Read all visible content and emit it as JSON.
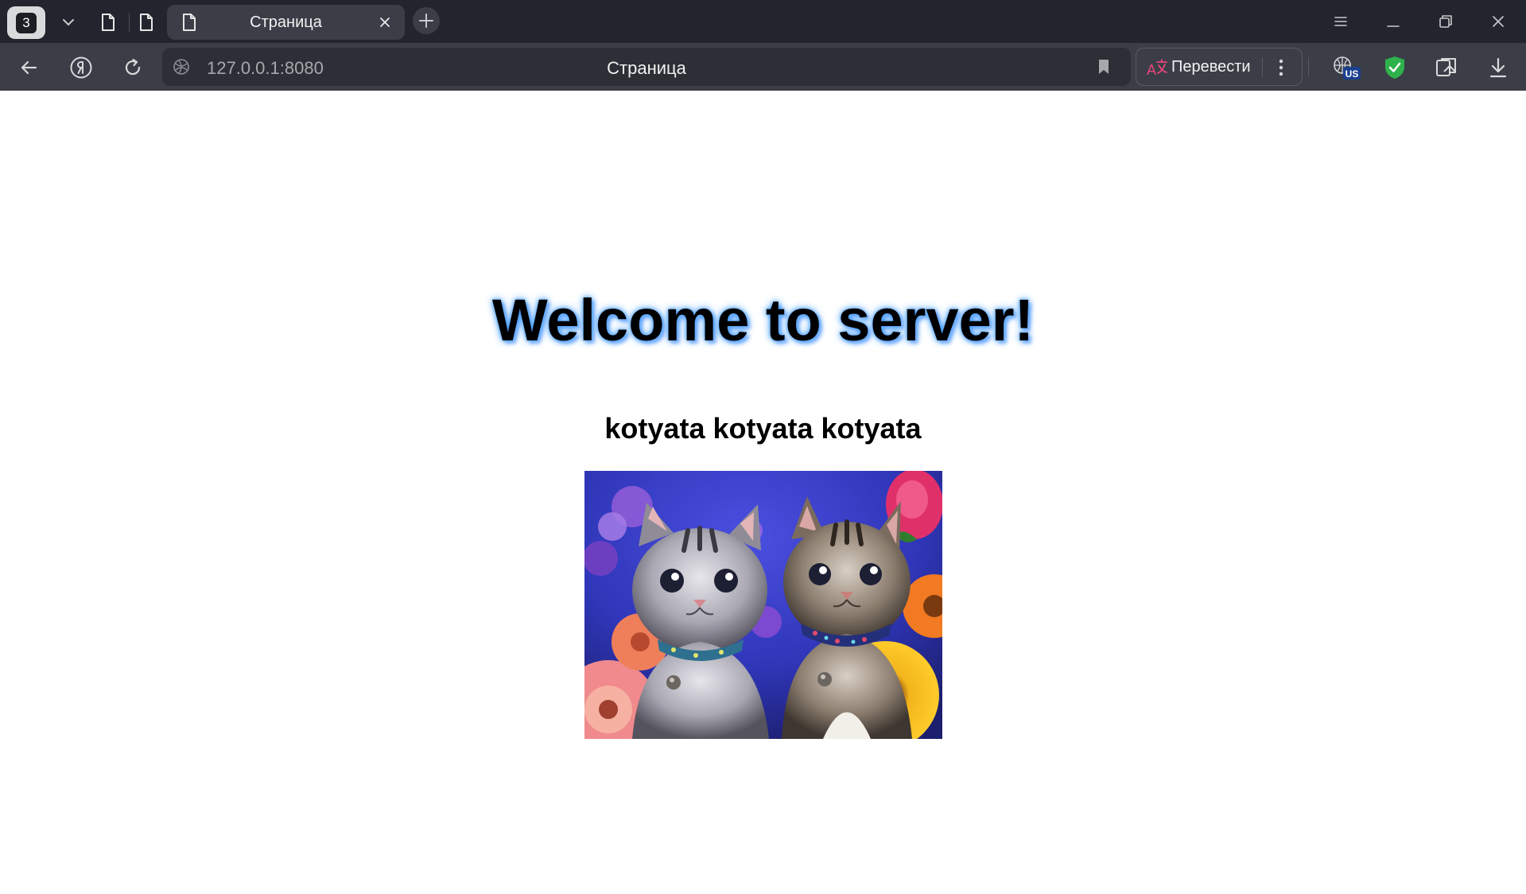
{
  "browser": {
    "tab_count": "3",
    "active_tab": {
      "title": "Страница"
    },
    "address_bar": {
      "url": "127.0.0.1:8080",
      "page_title": "Страница"
    },
    "translate": {
      "label": "Перевести"
    },
    "vpn_badge": "US",
    "icons": {
      "back": "back-arrow-icon",
      "yandex": "yandex-icon",
      "reload": "reload-icon",
      "bookmark": "bookmark-icon",
      "protect": "shield-check-icon",
      "download": "download-icon"
    },
    "colors": {
      "tabstrip": "#22252d",
      "toolbar": "#3b3e47",
      "omnibox": "#2c2f36",
      "translate_accent": "#e8467c",
      "shield": "#2fb24c"
    }
  },
  "page": {
    "heading": "Welcome to server!",
    "subheading": "kotyata kotyata kotyata",
    "heading_glow_color": "#3f9bff"
  }
}
